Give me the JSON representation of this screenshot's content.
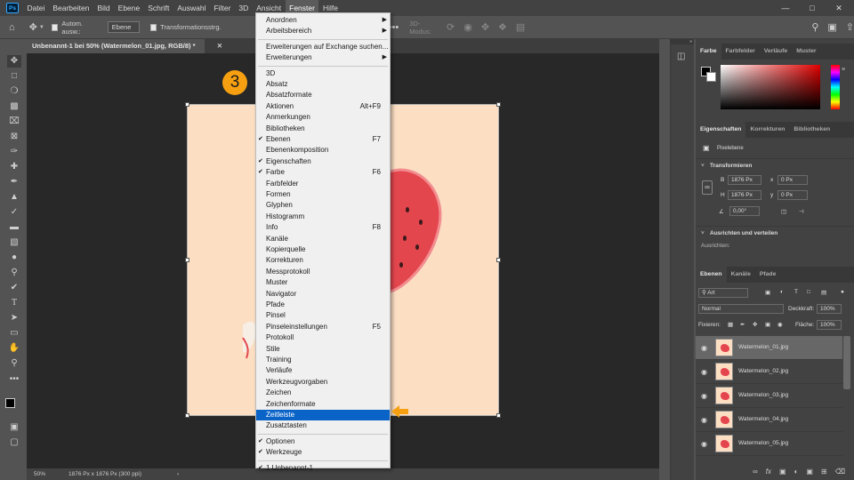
{
  "menubar": {
    "logo": "Ps",
    "items": [
      "Datei",
      "Bearbeiten",
      "Bild",
      "Ebene",
      "Schrift",
      "Auswahl",
      "Filter",
      "3D",
      "Ansicht",
      "Fenster",
      "Hilfe"
    ]
  },
  "options": {
    "autoselect_label": "Autom. ausw.:",
    "autoselect_value": "Ebene",
    "transform_label": "Transformationsstrg.",
    "mode3d_label": "3D-Modus:"
  },
  "document": {
    "tab_title": "Unbenannt-1 bei 50% (Watermelon_01.jpg, RGB/8) *",
    "callout": "3"
  },
  "status": {
    "zoom": "50%",
    "info": "1876 Px x 1876 Px (300 ppi)"
  },
  "fenster_menu": {
    "items": [
      {
        "label": "Anordnen",
        "submenu": true
      },
      {
        "label": "Arbeitsbereich",
        "submenu": true
      },
      {
        "sep": true
      },
      {
        "label": "Erweiterungen auf Exchange suchen..."
      },
      {
        "label": "Erweiterungen",
        "submenu": true
      },
      {
        "sep": true
      },
      {
        "label": "3D"
      },
      {
        "label": "Absatz"
      },
      {
        "label": "Absatzformate"
      },
      {
        "label": "Aktionen",
        "shortcut": "Alt+F9"
      },
      {
        "label": "Anmerkungen"
      },
      {
        "label": "Bibliotheken"
      },
      {
        "label": "Ebenen",
        "shortcut": "F7",
        "checked": true
      },
      {
        "label": "Ebenenkomposition"
      },
      {
        "label": "Eigenschaften",
        "checked": true
      },
      {
        "label": "Farbe",
        "shortcut": "F6",
        "checked": true
      },
      {
        "label": "Farbfelder"
      },
      {
        "label": "Formen"
      },
      {
        "label": "Glyphen"
      },
      {
        "label": "Histogramm"
      },
      {
        "label": "Info",
        "shortcut": "F8"
      },
      {
        "label": "Kanäle"
      },
      {
        "label": "Kopierquelle"
      },
      {
        "label": "Korrekturen"
      },
      {
        "label": "Messprotokoll"
      },
      {
        "label": "Muster"
      },
      {
        "label": "Navigator"
      },
      {
        "label": "Pfade"
      },
      {
        "label": "Pinsel"
      },
      {
        "label": "Pinseleinstellungen",
        "shortcut": "F5"
      },
      {
        "label": "Protokoll"
      },
      {
        "label": "Stile"
      },
      {
        "label": "Training"
      },
      {
        "label": "Verläufe"
      },
      {
        "label": "Werkzeugvorgaben"
      },
      {
        "label": "Zeichen"
      },
      {
        "label": "Zeichenformate"
      },
      {
        "label": "Zeitleiste",
        "highlighted": true
      },
      {
        "label": "Zusatztasten"
      },
      {
        "sep": true
      },
      {
        "label": "Optionen",
        "checked": true
      },
      {
        "label": "Werkzeuge",
        "checked": true
      },
      {
        "sep": true
      },
      {
        "label": "1 Unbenannt-1",
        "checked": true
      }
    ]
  },
  "color_panel": {
    "tabs": [
      "Farbe",
      "Farbfelder",
      "Verläufe",
      "Muster"
    ]
  },
  "properties_panel": {
    "tabs": [
      "Eigenschaften",
      "Korrekturen",
      "Bibliotheken"
    ],
    "layer_type": "Pixelebene",
    "transform_title": "Transformieren",
    "w_label": "B",
    "w_value": "1876 Px",
    "x_label": "x",
    "x_value": "0 Px",
    "h_label": "H",
    "h_value": "1876 Px",
    "y_label": "y",
    "y_value": "0 Px",
    "angle": "0,00°",
    "align_title": "Ausrichten und verteilen",
    "align_sub": "Ausrichten:"
  },
  "layers_panel": {
    "tabs": [
      "Ebenen",
      "Kanäle",
      "Pfade"
    ],
    "filter_label": "Art",
    "blend_mode": "Normal",
    "opacity_label": "Deckkraft:",
    "opacity_value": "100%",
    "lock_label": "Fixieren:",
    "fill_label": "Fläche:",
    "fill_value": "100%",
    "layers": [
      "Watermelon_01.jpg",
      "Watermelon_02.jpg",
      "Watermelon_03.jpg",
      "Watermelon_04.jpg",
      "Watermelon_05.jpg"
    ]
  },
  "colors": {
    "highlight": "#0a64c8",
    "callout": "#f6a011",
    "canvas_bg": "#fcdec3",
    "melon_red": "#e4464e"
  }
}
